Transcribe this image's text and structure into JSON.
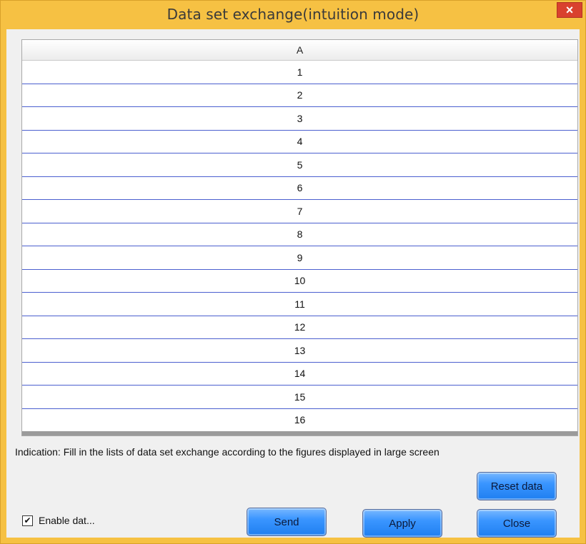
{
  "window": {
    "title": "Data set exchange(intuition mode)",
    "close_glyph": "×"
  },
  "table": {
    "column_header": "A",
    "rows": [
      "1",
      "2",
      "3",
      "4",
      "5",
      "6",
      "7",
      "8",
      "9",
      "10",
      "11",
      "12",
      "13",
      "14",
      "15",
      "16"
    ]
  },
  "indication": "Indication: Fill in the lists of data set exchange according to the figures displayed in large screen",
  "buttons": {
    "reset_label": "Reset data",
    "send_label": "Send",
    "apply_label": "Apply",
    "close_label": "Close"
  },
  "enable_checkbox": {
    "label": "Enable dat...",
    "checked_glyph": "✔"
  },
  "colors": {
    "frame": "#f6c143",
    "close_button": "#d9412e",
    "row_separator": "#4b5fcf",
    "button_blue": "#3a95ff"
  }
}
